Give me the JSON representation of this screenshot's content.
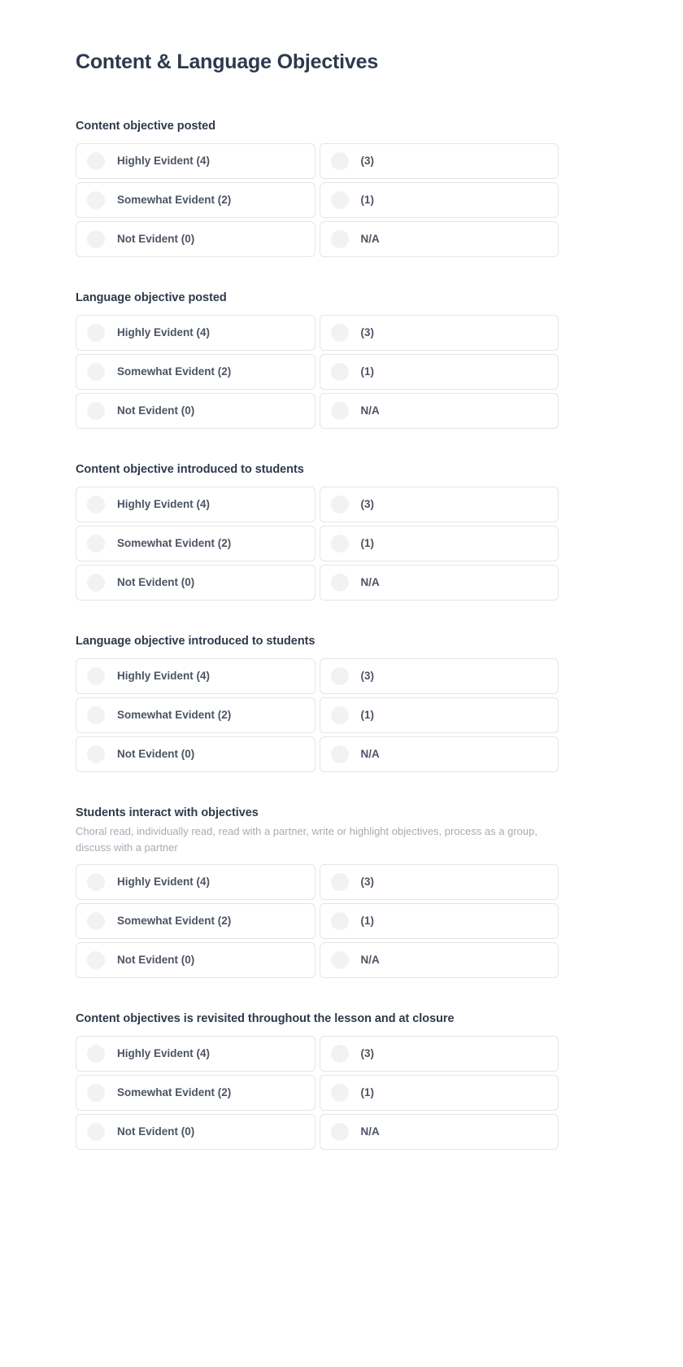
{
  "page": {
    "title": "Content & Language Objectives",
    "background_color": "#ffffff",
    "title_color": "#2e3a4c",
    "card_border_color": "#e4e5e8",
    "radio_color": "#f2f2f4",
    "label_color": "#4c5463",
    "subtitle_color": "#a9acb6"
  },
  "option_labels": {
    "highly_evident": "Highly Evident (4)",
    "three": "(3)",
    "somewhat_evident": "Somewhat Evident (2)",
    "one": "(1)",
    "not_evident": "Not Evident (0)",
    "na": "N/A"
  },
  "sections": [
    {
      "id": "content-objective-posted",
      "title": "Content objective posted",
      "subtitle": "",
      "options": [
        {
          "label": "Highly Evident (4)",
          "icon": "radio-unselected-icon",
          "selected": false
        },
        {
          "label": "(3)",
          "icon": "radio-unselected-icon",
          "selected": false
        },
        {
          "label": "Somewhat Evident (2)",
          "icon": "radio-unselected-icon",
          "selected": false
        },
        {
          "label": "(1)",
          "icon": "radio-unselected-icon",
          "selected": false
        },
        {
          "label": "Not Evident (0)",
          "icon": "radio-unselected-icon",
          "selected": false
        },
        {
          "label": "N/A",
          "icon": "radio-unselected-icon",
          "selected": false
        }
      ]
    },
    {
      "id": "language-objective-posted",
      "title": "Language objective posted",
      "subtitle": "",
      "options": [
        {
          "label": "Highly Evident (4)",
          "icon": "radio-unselected-icon",
          "selected": false
        },
        {
          "label": "(3)",
          "icon": "radio-unselected-icon",
          "selected": false
        },
        {
          "label": "Somewhat Evident (2)",
          "icon": "radio-unselected-icon",
          "selected": false
        },
        {
          "label": "(1)",
          "icon": "radio-unselected-icon",
          "selected": false
        },
        {
          "label": "Not Evident (0)",
          "icon": "radio-unselected-icon",
          "selected": false
        },
        {
          "label": "N/A",
          "icon": "radio-unselected-icon",
          "selected": false
        }
      ]
    },
    {
      "id": "content-objective-introduced",
      "title": "Content objective introduced to students",
      "subtitle": "",
      "options": [
        {
          "label": "Highly Evident (4)",
          "icon": "radio-unselected-icon",
          "selected": false
        },
        {
          "label": "(3)",
          "icon": "radio-unselected-icon",
          "selected": false
        },
        {
          "label": "Somewhat Evident (2)",
          "icon": "radio-unselected-icon",
          "selected": false
        },
        {
          "label": "(1)",
          "icon": "radio-unselected-icon",
          "selected": false
        },
        {
          "label": "Not Evident (0)",
          "icon": "radio-unselected-icon",
          "selected": false
        },
        {
          "label": "N/A",
          "icon": "radio-unselected-icon",
          "selected": false
        }
      ]
    },
    {
      "id": "language-objective-introduced",
      "title": "Language objective introduced to students",
      "subtitle": "",
      "options": [
        {
          "label": "Highly Evident (4)",
          "icon": "radio-unselected-icon",
          "selected": false
        },
        {
          "label": "(3)",
          "icon": "radio-unselected-icon",
          "selected": false
        },
        {
          "label": "Somewhat Evident (2)",
          "icon": "radio-unselected-icon",
          "selected": false
        },
        {
          "label": "(1)",
          "icon": "radio-unselected-icon",
          "selected": false
        },
        {
          "label": "Not Evident (0)",
          "icon": "radio-unselected-icon",
          "selected": false
        },
        {
          "label": "N/A",
          "icon": "radio-unselected-icon",
          "selected": false
        }
      ]
    },
    {
      "id": "students-interact-with-objectives",
      "title": "Students interact with objectives",
      "subtitle": "Choral read, individually read, read with a partner, write or highlight objectives, process as a group, discuss with a partner",
      "options": [
        {
          "label": "Highly Evident (4)",
          "icon": "radio-unselected-icon",
          "selected": false
        },
        {
          "label": "(3)",
          "icon": "radio-unselected-icon",
          "selected": false
        },
        {
          "label": "Somewhat Evident (2)",
          "icon": "radio-unselected-icon",
          "selected": false
        },
        {
          "label": "(1)",
          "icon": "radio-unselected-icon",
          "selected": false
        },
        {
          "label": "Not Evident (0)",
          "icon": "radio-unselected-icon",
          "selected": false
        },
        {
          "label": "N/A",
          "icon": "radio-unselected-icon",
          "selected": false
        }
      ]
    },
    {
      "id": "content-objectives-revisited",
      "title": "Content objectives is revisited throughout the lesson and at closure",
      "subtitle": "",
      "options": [
        {
          "label": "Highly Evident (4)",
          "icon": "radio-unselected-icon",
          "selected": false
        },
        {
          "label": "(3)",
          "icon": "radio-unselected-icon",
          "selected": false
        },
        {
          "label": "Somewhat Evident (2)",
          "icon": "radio-unselected-icon",
          "selected": false
        },
        {
          "label": "(1)",
          "icon": "radio-unselected-icon",
          "selected": false
        },
        {
          "label": "Not Evident (0)",
          "icon": "radio-unselected-icon",
          "selected": false
        },
        {
          "label": "N/A",
          "icon": "radio-unselected-icon",
          "selected": false
        }
      ]
    }
  ]
}
